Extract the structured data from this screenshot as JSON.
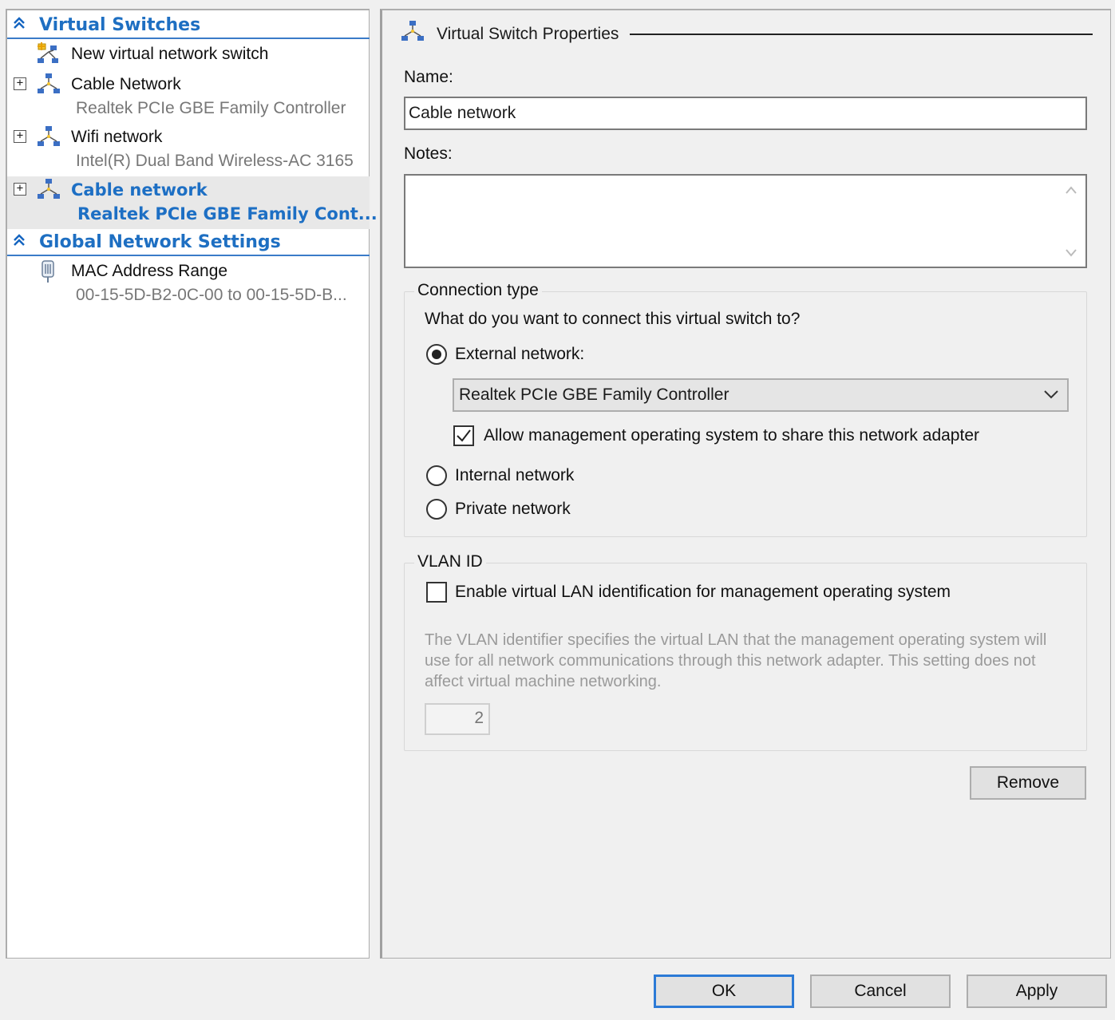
{
  "sidebar": {
    "virtual_switches_header": "Virtual Switches",
    "items": [
      {
        "label": "New virtual network switch"
      },
      {
        "label": "Cable Network",
        "sub": "Realtek PCIe GBE Family Controller"
      },
      {
        "label": "Wifi network",
        "sub": "Intel(R) Dual Band Wireless-AC 3165"
      },
      {
        "label": "Cable network",
        "sub": "Realtek PCIe GBE Family Cont...",
        "selected": true
      }
    ],
    "global_header": "Global Network Settings",
    "global_items": [
      {
        "label": "MAC Address Range",
        "sub": "00-15-5D-B2-0C-00 to 00-15-5D-B..."
      }
    ]
  },
  "properties": {
    "title": "Virtual Switch Properties",
    "name_label": "Name:",
    "name_value": "Cable network",
    "notes_label": "Notes:",
    "notes_value": "",
    "connection_group_title": "Connection type",
    "connection_question": "What do you want to connect this virtual switch to?",
    "external_label": "External network:",
    "external_adapter": "Realtek PCIe GBE Family Controller",
    "allow_mgmt_label": "Allow management operating system to share this network adapter",
    "internal_label": "Internal network",
    "private_label": "Private network",
    "vlan_group_title": "VLAN ID",
    "vlan_enable_label": "Enable virtual LAN identification for management operating system",
    "vlan_description": "The VLAN identifier specifies the virtual LAN that the management operating system will use for all network communications through this network adapter. This setting does not affect virtual machine networking.",
    "vlan_value": "2",
    "remove_label": "Remove"
  },
  "footer": {
    "ok_label": "OK",
    "cancel_label": "Cancel",
    "apply_label": "Apply"
  },
  "state": {
    "connection_type": "external",
    "allow_mgmt_checked": true,
    "vlan_enabled": false
  },
  "colors": {
    "accent": "#1e6fc2",
    "default_button_border": "#2c7ad6"
  }
}
